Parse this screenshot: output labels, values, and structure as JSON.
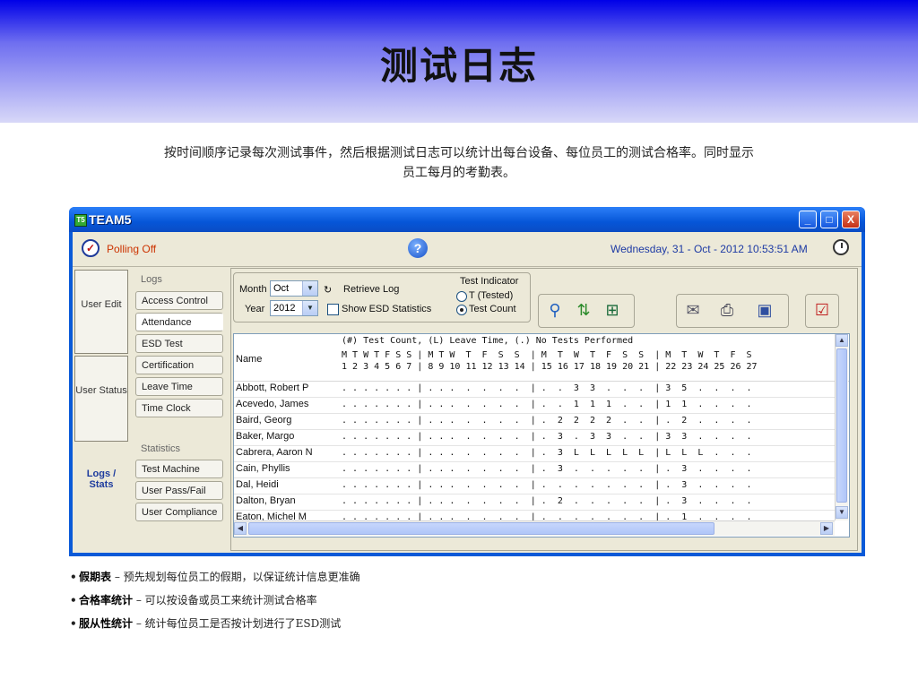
{
  "slide": {
    "title": "测试日志",
    "intro_line1": "按时间顺序记录每次测试事件，然后根据测试日志可以统计出每台设备、每位员工的测试合格率。同时显示",
    "intro_line2": "员工每月的考勤表。",
    "bullets": [
      {
        "term": "假期表",
        "sep": " – ",
        "text": "预先规划每位员工的假期，以保证统计信息更准确"
      },
      {
        "term": "合格率统计",
        "sep": " – ",
        "text": "可以按设备或员工来统计测试合格率"
      },
      {
        "term": "服从性统计",
        "sep": " – ",
        "text": "统计每位员工是否按计划进行了ESD测试"
      }
    ]
  },
  "window": {
    "title": "TEAM5",
    "logo": "T5",
    "controls": {
      "minimize": "_",
      "maximize": "□",
      "close": "X"
    }
  },
  "statusbar": {
    "polling": "Polling Off",
    "help": "?",
    "datetime": "Wednesday, 31 - Oct - 2012   10:53:51 AM"
  },
  "nav": {
    "tabs": [
      {
        "label": "User Edit"
      },
      {
        "label": "User Status"
      },
      {
        "label": "Logs / Stats"
      }
    ],
    "logs_label": "Logs",
    "logs_items": [
      "Access Control",
      "Attendance",
      "ESD Test",
      "Certification",
      "Leave Time",
      "Time Clock"
    ],
    "stats_label": "Statistics",
    "stats_items": [
      "Test Machine",
      "User Pass/Fail",
      "User Compliance"
    ]
  },
  "controls": {
    "month_label": "Month",
    "month_value": "Oct",
    "year_label": "Year",
    "year_value": "2012",
    "retrieve": "Retrieve Log",
    "show_esd": "Show ESD Statistics",
    "indicator_title": "Test Indicator",
    "opt_tested": "T (Tested)",
    "opt_count": "Test Count"
  },
  "grid": {
    "legend": "(#) Test Count, (L) Leave Time, (.) No Tests Performed",
    "name_header": "Name",
    "days_row": "M T W T F S S | M T W  T  F  S  S  | M  T  W  T  F  S  S  | M  T  W  T  F  S",
    "dates_row": "1 2 3 4 5 6 7 | 8 9 10 11 12 13 14 | 15 16 17 18 19 20 21 | 22 23 24 25 26 27",
    "rows": [
      {
        "name": "Abbott, Robert P",
        "vals": ". . . . . . . | . . .  .  .  .  .  | .  .  3  3  .  .  .  | 3  5  .  .  .  ."
      },
      {
        "name": "Acevedo, James",
        "vals": ". . . . . . . | . . .  .  .  .  .  | .  .  1  1  1  .  .  | 1  1  .  .  .  ."
      },
      {
        "name": "Baird, Georg",
        "vals": ". . . . . . . | . . .  .  .  .  .  | .  2  2  2  2  .  .  | .  2  .  .  .  ."
      },
      {
        "name": "Baker, Margo",
        "vals": ". . . . . . . | . . .  .  .  .  .  | .  3  .  3  3  .  .  | 3  3  .  .  .  ."
      },
      {
        "name": "Cabrera, Aaron N",
        "vals": ". . . . . . . | . . .  .  .  .  .  | .  3  L  L  L  L  L  | L  L  L  .  .  ."
      },
      {
        "name": "Cain, Phyllis",
        "vals": ". . . . . . . | . . .  .  .  .  .  | .  3  .  .  .  .  .  | .  3  .  .  .  ."
      },
      {
        "name": "Dal, Heidi",
        "vals": ". . . . . . . | . . .  .  .  .  .  | .  .  .  .  .  .  .  | .  3  .  .  .  ."
      },
      {
        "name": "Dalton, Bryan",
        "vals": ". . . . . . . | . . .  .  .  .  .  | .  2  .  .  .  .  .  | .  3  .  .  .  ."
      },
      {
        "name": "Eaton, Michel M",
        "vals": ". . . . . . . | . . .  .  .  .  .  | .  .  .  .  .  .  .  | .  1  .  .  .  ."
      }
    ]
  }
}
